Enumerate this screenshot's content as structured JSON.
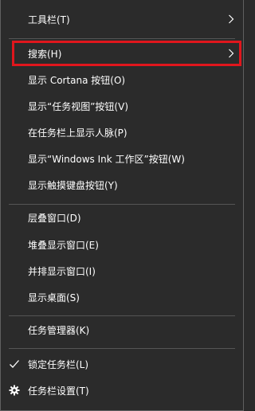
{
  "menu": {
    "items": [
      {
        "label": "工具栏(T)",
        "submenu": true
      },
      {
        "label": "搜索(H)",
        "submenu": true,
        "highlighted": true
      },
      {
        "label": "显示 Cortana 按钮(O)"
      },
      {
        "label": "显示“任务视图”按钮(V)"
      },
      {
        "label": "在任务栏上显示人脉(P)"
      },
      {
        "label": "显示“Windows Ink 工作区”按钮(W)"
      },
      {
        "label": "显示触摸键盘按钮(Y)"
      },
      {
        "label": "层叠窗口(D)"
      },
      {
        "label": "堆叠显示窗口(E)"
      },
      {
        "label": "并排显示窗口(I)"
      },
      {
        "label": "显示桌面(S)"
      },
      {
        "label": "任务管理器(K)"
      },
      {
        "label": "锁定任务栏(L)",
        "checked": true
      },
      {
        "label": "任务栏设置(T)",
        "icon": "gear-icon"
      }
    ]
  },
  "colors": {
    "background": "#2b2b2b",
    "text": "#ffffff",
    "separator": "#555555",
    "highlight_border": "#e0161d"
  }
}
